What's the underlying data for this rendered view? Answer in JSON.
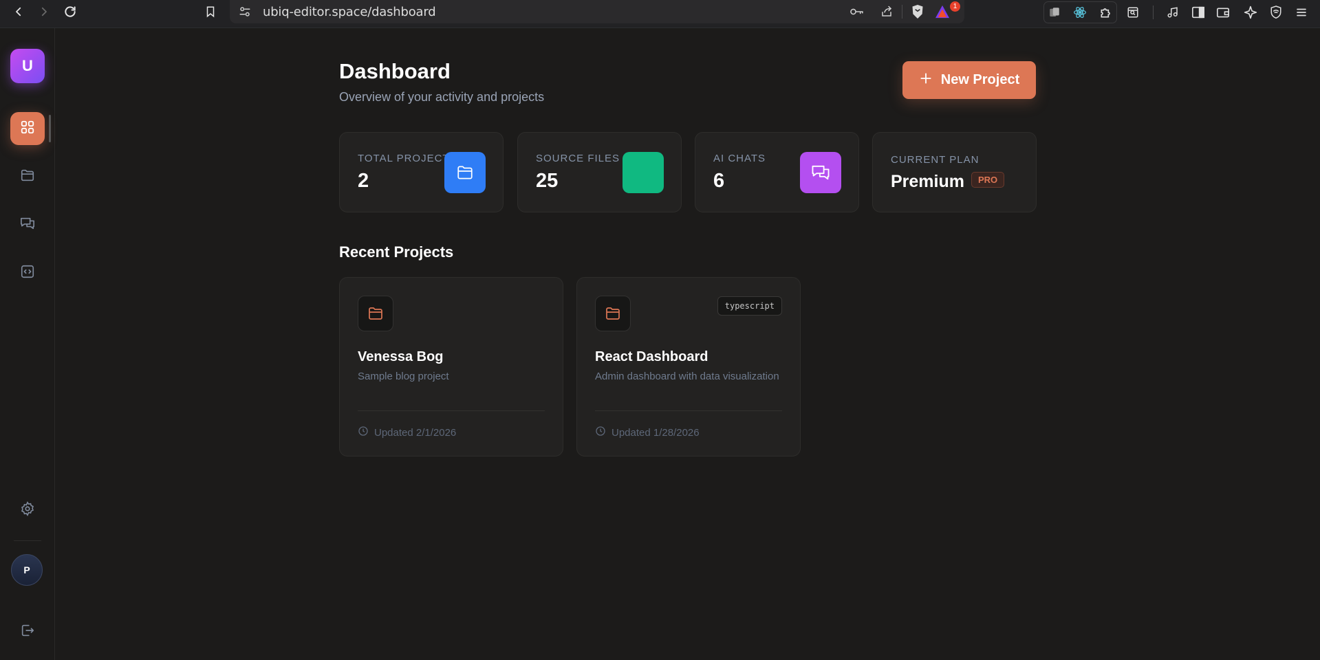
{
  "browser": {
    "url": "ubiq-editor.space/dashboard",
    "notification_count": "1"
  },
  "sidebar": {
    "logo_letter": "U",
    "items": [
      {
        "name": "dashboard",
        "icon": "grid-icon",
        "active": true
      },
      {
        "name": "projects",
        "icon": "folder-icon",
        "active": false
      },
      {
        "name": "chats",
        "icon": "chat-icon",
        "active": false
      },
      {
        "name": "code",
        "icon": "code-icon",
        "active": false
      }
    ],
    "avatar_letter": "P"
  },
  "header": {
    "title": "Dashboard",
    "subtitle": "Overview of your activity and projects",
    "new_project_label": "New Project"
  },
  "stats": [
    {
      "label": "Total Projects",
      "value": "2",
      "icon": "folder-icon",
      "color": "#2f7df6"
    },
    {
      "label": "Source Files",
      "value": "25",
      "icon": "file-icon",
      "color": "#10b981"
    },
    {
      "label": "AI Chats",
      "value": "6",
      "icon": "chat-icon",
      "color": "#b44ff0"
    },
    {
      "label": "Current Plan",
      "value": "Premium",
      "badge": "PRO"
    }
  ],
  "recent": {
    "title": "Recent Projects",
    "projects": [
      {
        "name": "Venessa Bog",
        "description": "Sample blog project",
        "updated": "Updated 2/1/2026",
        "tag": ""
      },
      {
        "name": "React Dashboard",
        "description": "Admin dashboard with data visualization",
        "updated": "Updated 1/28/2026",
        "tag": "typescript"
      }
    ]
  },
  "colors": {
    "accent": "#dd7755",
    "background": "#1c1b1a",
    "card": "#232221"
  }
}
